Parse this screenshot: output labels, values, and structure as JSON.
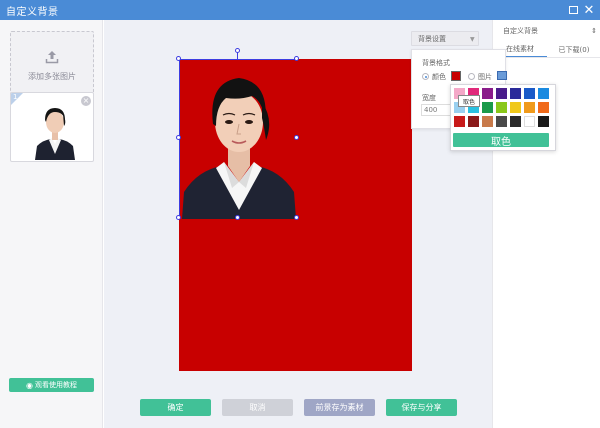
{
  "window": {
    "title": "自定义背景"
  },
  "left_panel": {
    "upload_label": "添加多张图片",
    "thumb_index": "1",
    "tutorial_label": "观看使用教程"
  },
  "toolbar": {
    "confirm_label": "确定",
    "cancel_label": "取消",
    "store_label": "前景存为素材",
    "save_share_label": "保存与分享"
  },
  "right_panel": {
    "select_value": "自定义背景",
    "tabs": [
      {
        "label": "在线素材"
      },
      {
        "label": "已下载(0)"
      }
    ]
  },
  "bg_settings": {
    "button_label": "背景设置",
    "style_label": "背景格式",
    "option_color": "颜色",
    "option_image": "图片",
    "width_label": "宽度",
    "width_value": "400",
    "selected_color": "#c80000"
  },
  "color_picker": {
    "tooltip": "取色",
    "pick_label": "取色",
    "swatches": [
      [
        "#f4a8c8",
        "#e0287a",
        "#8a1c8a",
        "#4a1c8a",
        "#2a2a9a",
        "#1a5ac8",
        "#1a8ae0"
      ],
      [
        "#9ad0f0",
        "#2ac0e0",
        "#1a9a4a",
        "#8ac81a",
        "#f0c81a",
        "#f09a1a",
        "#f06a1a"
      ],
      [
        "#c81a1a",
        "#8a1a1a",
        "#c87a4a",
        "#4a4a4a",
        "#2a2a2a",
        "#ffffff",
        "#1a1a1a"
      ]
    ]
  }
}
